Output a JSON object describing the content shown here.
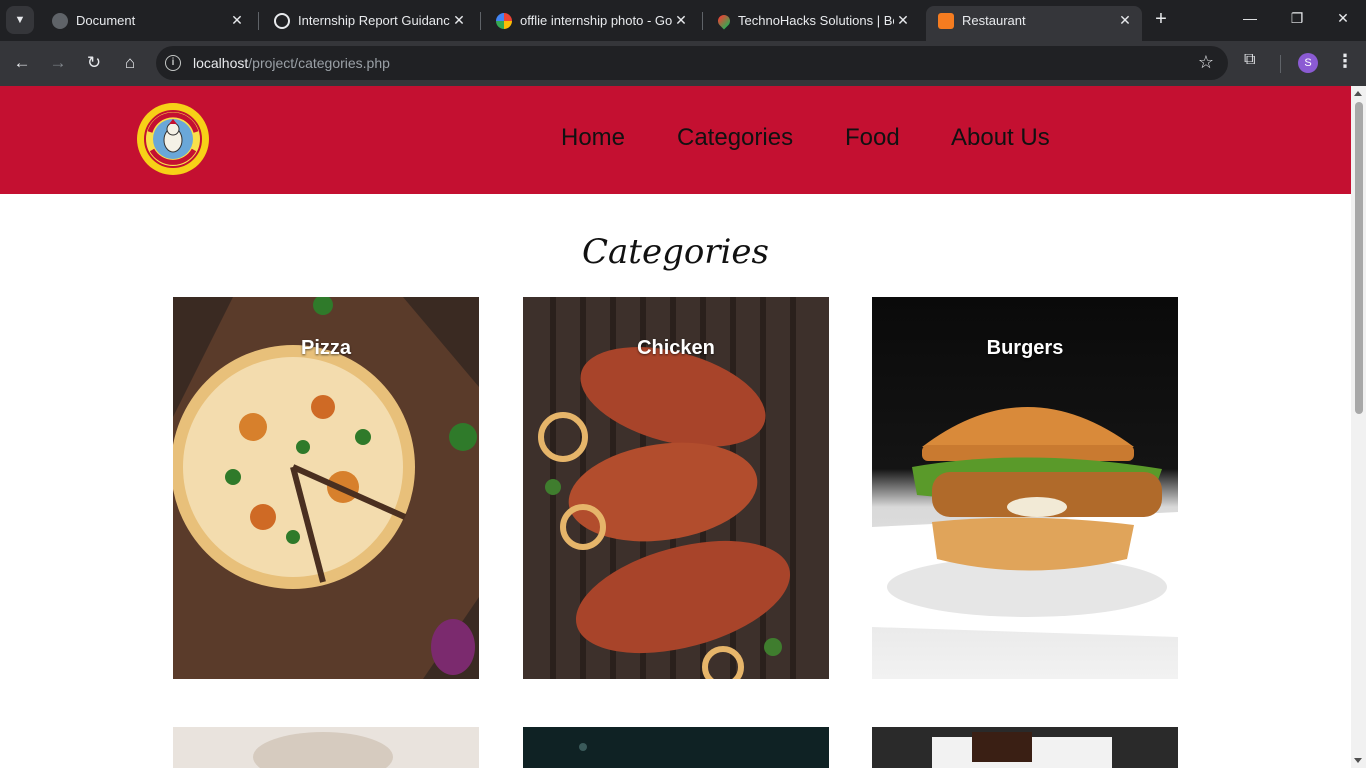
{
  "browser": {
    "tabs": [
      {
        "title": "Document"
      },
      {
        "title": "Internship Report Guidance"
      },
      {
        "title": "offlie internship photo - Goo"
      },
      {
        "title": "TechnoHacks Solutions | Bes"
      },
      {
        "title": "Restaurant"
      }
    ],
    "url_host": "localhost",
    "url_path": "/project/categories.php",
    "profile_initial": "S"
  },
  "site": {
    "nav": [
      "Home",
      "Categories",
      "Food",
      "About Us"
    ],
    "section_title": "Categories",
    "categories": [
      {
        "name": "Pizza"
      },
      {
        "name": "Chicken"
      },
      {
        "name": "Burgers"
      }
    ],
    "header_color": "#c41031"
  }
}
